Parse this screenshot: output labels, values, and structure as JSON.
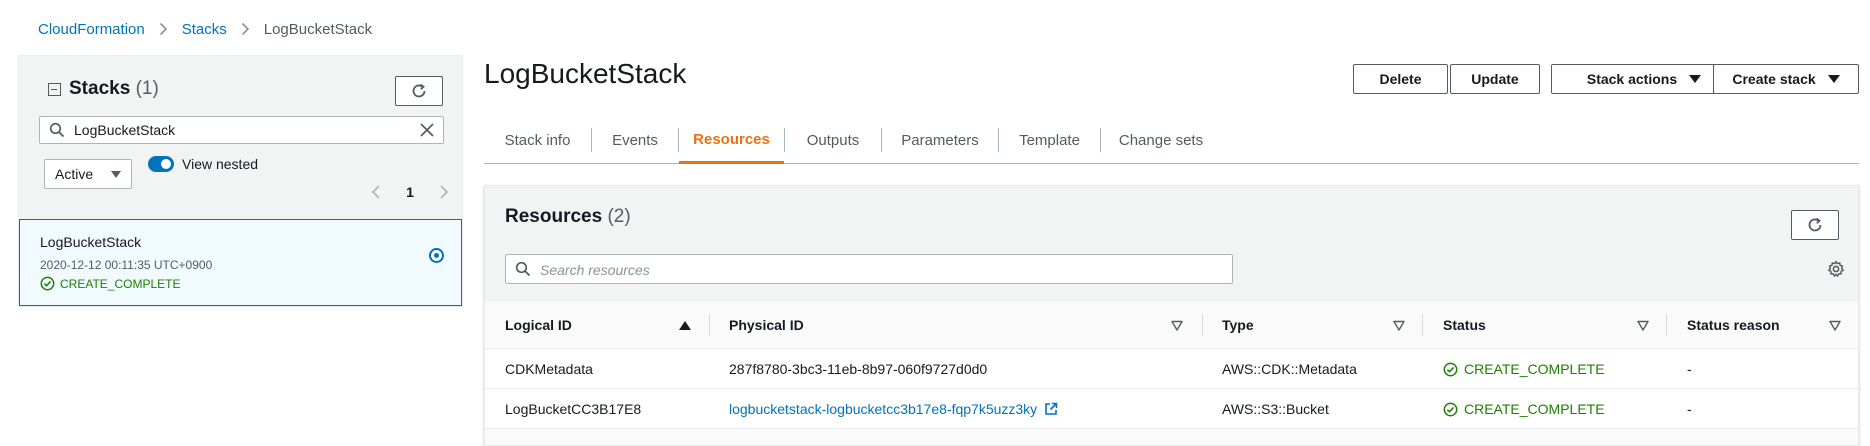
{
  "breadcrumb": {
    "items": [
      "CloudFormation",
      "Stacks"
    ],
    "current": "LogBucketStack"
  },
  "stacks_panel": {
    "title": "Stacks",
    "count": "(1)",
    "search_value": "LogBucketStack",
    "filter_selected": "Active",
    "toggle_label": "View nested",
    "toggle_on": true,
    "page_number": "1"
  },
  "stack_item": {
    "name": "LogBucketStack",
    "date": "2020-12-12 00:11:35 UTC+0900",
    "status": "CREATE_COMPLETE",
    "selected": true
  },
  "header": {
    "title": "LogBucketStack",
    "buttons": {
      "delete": "Delete",
      "update": "Update",
      "stack_actions": "Stack actions",
      "create_stack": "Create stack"
    }
  },
  "tabs": [
    "Stack info",
    "Events",
    "Resources",
    "Outputs",
    "Parameters",
    "Template",
    "Change sets"
  ],
  "active_tab": "Resources",
  "resources": {
    "title": "Resources",
    "count": "(2)",
    "search_placeholder": "Search resources",
    "columns": [
      "Logical ID",
      "Physical ID",
      "Type",
      "Status",
      "Status reason"
    ],
    "rows": [
      {
        "logical_id": "CDKMetadata",
        "physical_id": "287f8780-3bc3-11eb-8b97-060f9727d0d0",
        "type": "AWS::CDK::Metadata",
        "status": "CREATE_COMPLETE",
        "reason": "-"
      },
      {
        "logical_id": "LogBucketCC3B17E8",
        "physical_id": "logbucketstack-logbucketcc3b17e8-fqp7k5uzz3ky",
        "type": "AWS::S3::Bucket",
        "status": "CREATE_COMPLETE",
        "reason": "-"
      }
    ]
  },
  "colors": {
    "link": "#0073bb",
    "accent_tab": "#ec7211",
    "success": "#1d8102"
  }
}
